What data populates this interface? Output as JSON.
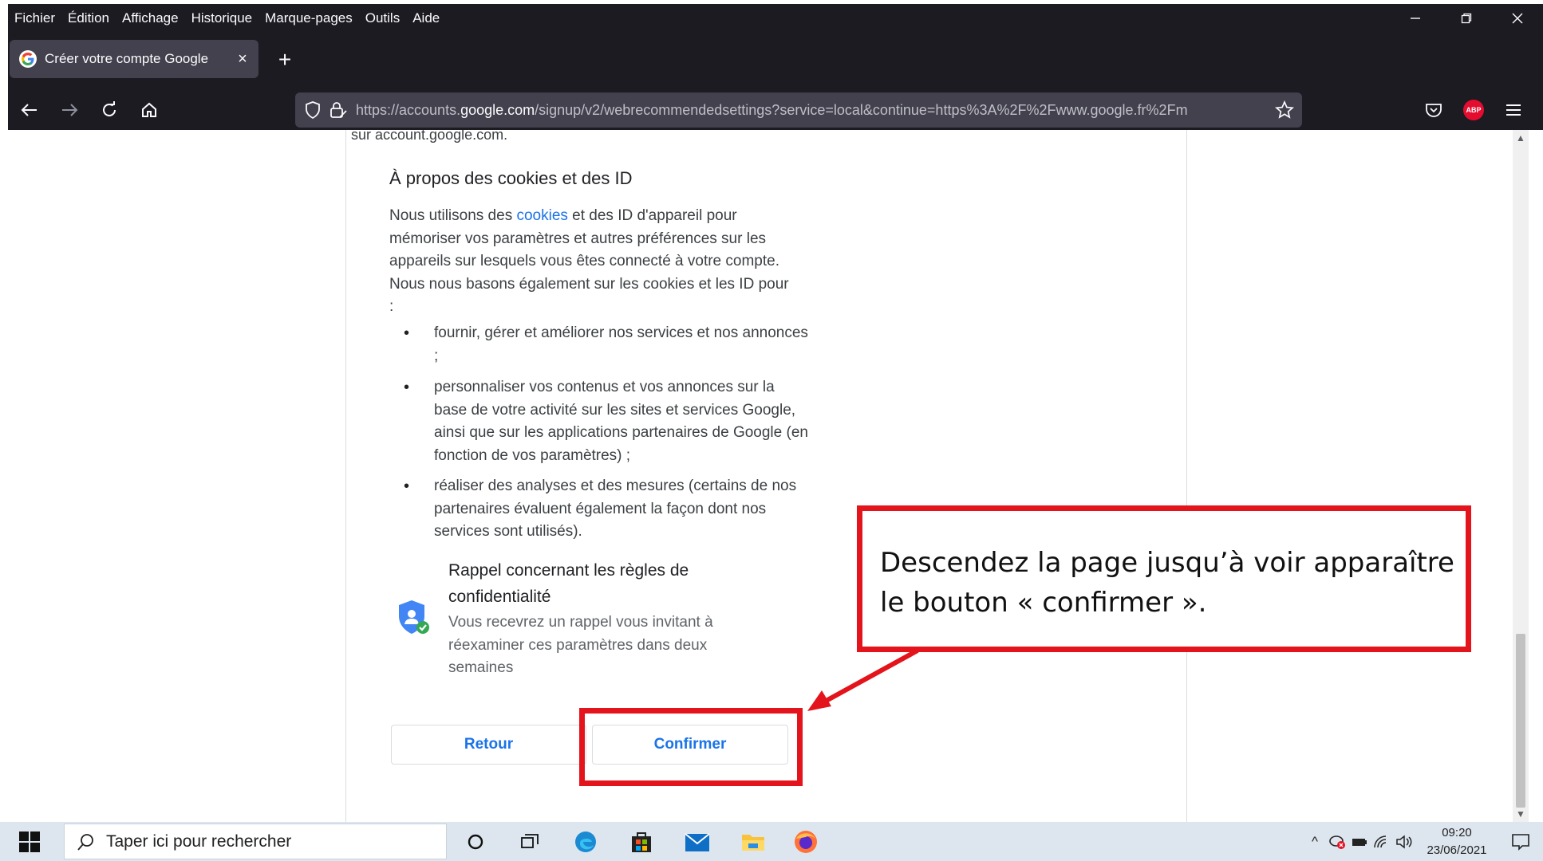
{
  "menubar": {
    "items": [
      "Fichier",
      "Édition",
      "Affichage",
      "Historique",
      "Marque-pages",
      "Outils",
      "Aide"
    ]
  },
  "tab": {
    "title": "Créer votre compte Google",
    "close": "×"
  },
  "newtab": "+",
  "urlbar": {
    "url_host_prefix": "https://accounts.",
    "url_host": "google.com",
    "url_path": "/signup/v2/webrecommendedsettings?service=local&continue=https%3A%2F%2Fwww.google.fr%2Fm"
  },
  "page": {
    "cut_text": "sur account.google.com.",
    "section_title": "À propos des cookies et des ID",
    "para_before_link": "Nous utilisons des ",
    "para_link": "cookies",
    "para_after_link": " et des ID d'appareil pour mémoriser vos paramètres et autres préférences sur les appareils sur lesquels vous êtes connecté à votre compte. Nous nous basons également sur les cookies et les ID pour :",
    "bullets": [
      "fournir, gérer et améliorer nos services et nos annonces ;",
      "personnaliser vos contenus et vos annonces sur la base de votre activité sur les sites et services Google, ainsi que sur les applications partenaires de Google (en fonction de vos paramètres) ;",
      "réaliser des analyses et des mesures (certains de nos partenaires évaluent également la façon dont nos services sont utilisés)."
    ],
    "reminder_title": "Rappel concernant les règles de confidentialité",
    "reminder_body": "Vous recevrez un rappel vous invitant à réexaminer ces paramètres dans deux semaines",
    "back_label": "Retour",
    "confirm_label": "Confirmer"
  },
  "annotation": {
    "callout_text": "Descendez la page jusqu’à voir apparaître le bouton « confirmer ».",
    "color": "#e3141b"
  },
  "taskbar": {
    "search_placeholder": "Taper ici pour rechercher",
    "time": "09:20",
    "date": "23/06/2021"
  },
  "colors": {
    "browser_dark": "#1c1b22",
    "google_blue": "#1a73e8"
  }
}
